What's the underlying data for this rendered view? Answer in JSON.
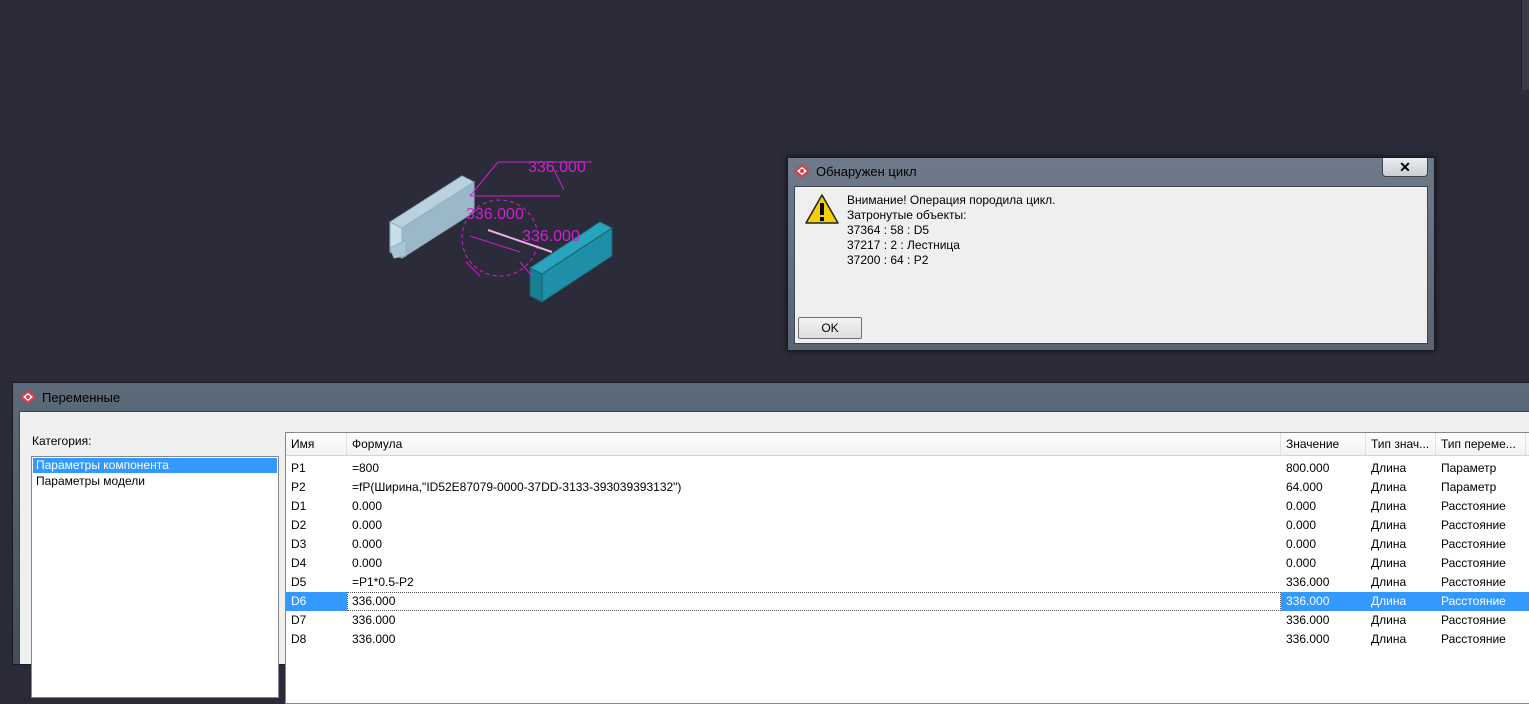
{
  "viewport": {
    "dimension_labels": [
      "336.000",
      "336.000",
      "336.000"
    ],
    "colors": {
      "dimension": "#d020d0",
      "beam_left": "#a9c6d6",
      "beam_right": "#1f8fa8",
      "background": "#2b2b39"
    }
  },
  "alert": {
    "title": "Обнаружен цикл",
    "close_glyph": "✕",
    "lines": [
      "Внимание! Операция породила цикл.",
      "Затронутые объекты:",
      "37364 : 58 : D5",
      "37217 : 2 : Лестница",
      "37200 : 64 : P2"
    ],
    "ok_label": "OK",
    "icon": "warning-icon"
  },
  "variables": {
    "title": "Переменные",
    "category_label": "Категория:",
    "categories": [
      "Параметры компонента",
      "Параметры модели"
    ],
    "selected_category": 0,
    "columns": [
      "Имя",
      "Формула",
      "Значение",
      "Тип знач...",
      "Тип переме..."
    ],
    "rows": [
      {
        "name": "P1",
        "formula": "=800",
        "value": "800.000",
        "vtype": "Длина",
        "kind": "Параметр"
      },
      {
        "name": "P2",
        "formula": "=fP(Ширина,\"ID52E87079-0000-37DD-3133-393039393132\")",
        "value": "64.000",
        "vtype": "Длина",
        "kind": "Параметр"
      },
      {
        "name": "D1",
        "formula": "0.000",
        "value": "0.000",
        "vtype": "Длина",
        "kind": "Расстояние"
      },
      {
        "name": "D2",
        "formula": "0.000",
        "value": "0.000",
        "vtype": "Длина",
        "kind": "Расстояние"
      },
      {
        "name": "D3",
        "formula": "0.000",
        "value": "0.000",
        "vtype": "Длина",
        "kind": "Расстояние"
      },
      {
        "name": "D4",
        "formula": "0.000",
        "value": "0.000",
        "vtype": "Длина",
        "kind": "Расстояние"
      },
      {
        "name": "D5",
        "formula": "=P1*0.5-P2",
        "value": "336.000",
        "vtype": "Длина",
        "kind": "Расстояние"
      },
      {
        "name": "D6",
        "formula": "336.000",
        "value": "336.000",
        "vtype": "Длина",
        "kind": "Расстояние"
      },
      {
        "name": "D7",
        "formula": "336.000",
        "value": "336.000",
        "vtype": "Длина",
        "kind": "Расстояние"
      },
      {
        "name": "D8",
        "formula": "336.000",
        "value": "336.000",
        "vtype": "Длина",
        "kind": "Расстояние"
      }
    ],
    "selected_row": 7
  }
}
